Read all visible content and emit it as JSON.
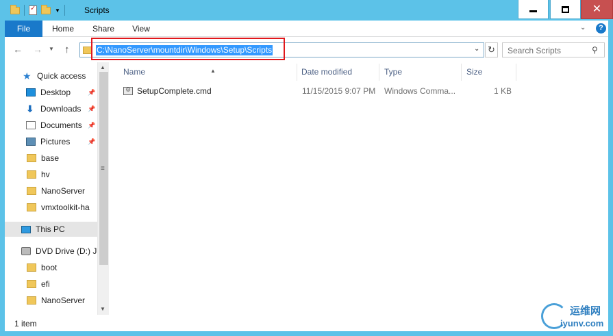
{
  "window": {
    "title": "Scripts"
  },
  "ribbon": {
    "tabs": [
      "File",
      "Home",
      "Share",
      "View"
    ]
  },
  "address": {
    "path": "C:\\NanoServer\\mountdir\\Windows\\Setup\\Scripts"
  },
  "search": {
    "placeholder": "Search Scripts"
  },
  "navpane": {
    "items": [
      {
        "label": "Quick access",
        "icon": "star-icon"
      },
      {
        "label": "Desktop",
        "icon": "desktop-icon",
        "pinned": true
      },
      {
        "label": "Downloads",
        "icon": "downloads-icon",
        "pinned": true
      },
      {
        "label": "Documents",
        "icon": "documents-icon",
        "pinned": true
      },
      {
        "label": "Pictures",
        "icon": "pictures-icon",
        "pinned": true
      },
      {
        "label": "base",
        "icon": "folder-icon"
      },
      {
        "label": "hv",
        "icon": "folder-icon"
      },
      {
        "label": "NanoServer",
        "icon": "folder-icon"
      },
      {
        "label": "vmxtoolkit-ha",
        "icon": "folder-icon"
      },
      {
        "label": "This PC",
        "icon": "pc-icon"
      },
      {
        "label": "DVD Drive (D:) J",
        "icon": "dvd-icon"
      },
      {
        "label": "boot",
        "icon": "folder-icon"
      },
      {
        "label": "efi",
        "icon": "folder-icon"
      },
      {
        "label": "NanoServer",
        "icon": "folder-icon"
      }
    ]
  },
  "columns": {
    "name": "Name",
    "date": "Date modified",
    "type": "Type",
    "size": "Size"
  },
  "files": [
    {
      "name": "SetupComplete.cmd",
      "date": "11/15/2015 9:07 PM",
      "type": "Windows Comma...",
      "size": "1 KB"
    }
  ],
  "status": {
    "count": "1 item"
  },
  "watermark": {
    "cn": "运维网",
    "en": "iyunv.com"
  },
  "colors": {
    "accent": "#1979ca",
    "titlebar": "#5cc2e8",
    "selection": "#3399ff",
    "highlight_box": "#e0181c"
  }
}
